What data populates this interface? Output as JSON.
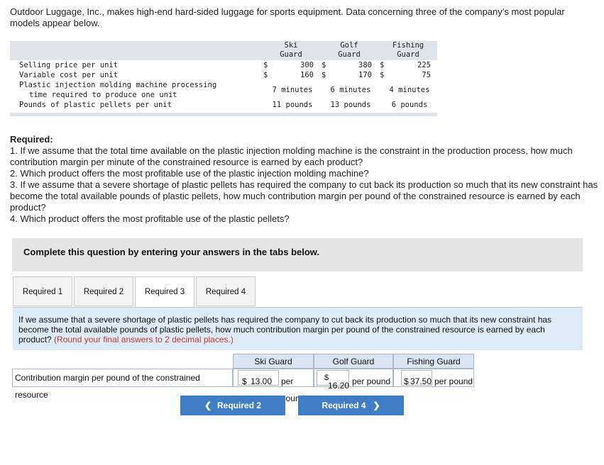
{
  "intro": "Outdoor Luggage, Inc., makes high-end hard-sided luggage for sports equipment. Data concerning three of the company’s most popular models appear below.",
  "table": {
    "headers": [
      [
        "Ski",
        "Guard"
      ],
      [
        "Golf",
        "Guard"
      ],
      [
        "Fishing",
        "Guard"
      ]
    ],
    "rows": [
      {
        "label": "Selling price per unit",
        "cur": [
          "$",
          "$",
          "$"
        ],
        "values": [
          "300",
          "380",
          "225"
        ]
      },
      {
        "label": "Variable cost per unit",
        "cur": [
          "$",
          "$",
          "$"
        ],
        "values": [
          "160",
          "170",
          "75"
        ]
      },
      {
        "label1": "Plastic injection molding machine processing",
        "label2": "time required to produce one unit",
        "values": [
          "7 minutes",
          "6 minutes",
          "4 minutes"
        ]
      },
      {
        "label": "Pounds of plastic pellets per unit",
        "values": [
          "11 pounds",
          "13 pounds",
          "6 pounds"
        ]
      }
    ]
  },
  "required": {
    "title": "Required:",
    "items": [
      "1. If we assume that the total time available on the plastic injection molding machine is the constraint in the production process, how much contribution margin per minute of the constrained resource is earned by each product?",
      "2. Which product offers the most profitable use of the plastic injection molding machine?",
      "3. If we assume that a severe shortage of plastic pellets has required the company to cut back its production so much that its new constraint has become the total available pounds of plastic pellets, how much contribution margin per pound of the constrained resource is earned by each product?",
      "4. Which product offers the most profitable use of the plastic pellets?"
    ]
  },
  "banner": "Complete this question by entering your answers in the tabs below.",
  "tabs": [
    "Required 1",
    "Required 2",
    "Required 3",
    "Required 4"
  ],
  "active_tab": "Required 3",
  "panel": {
    "text": "If we assume that a severe shortage of plastic pellets has required the company to cut back its production so much that its new constraint has become the total available pounds of plastic pellets, how much contribution margin per pound of the constrained resource is earned by each product?",
    "note": "(Round your final answers to 2 decimal places.)"
  },
  "answer": {
    "headers": [
      "Ski Guard",
      "Golf Guard",
      "Fishing Guard"
    ],
    "row_label": "Contribution margin per pound of the constrained resource",
    "cells": [
      {
        "currency": "$",
        "value": "13.00",
        "unit": "per pound"
      },
      {
        "currency": "$",
        "value": "16.20",
        "unit": "per pound"
      },
      {
        "currency": "$",
        "value": "37.50",
        "unit": "per pound"
      }
    ]
  },
  "nav": {
    "prev": "Required 2",
    "next": "Required 4",
    "prev_icon": "chevron-left-icon",
    "next_icon": "chevron-right-icon"
  },
  "colors": {
    "button": "#3f7dc4",
    "panel": "#dcebf7",
    "table_header": "#dfe3ec",
    "note": "#c0392b"
  }
}
